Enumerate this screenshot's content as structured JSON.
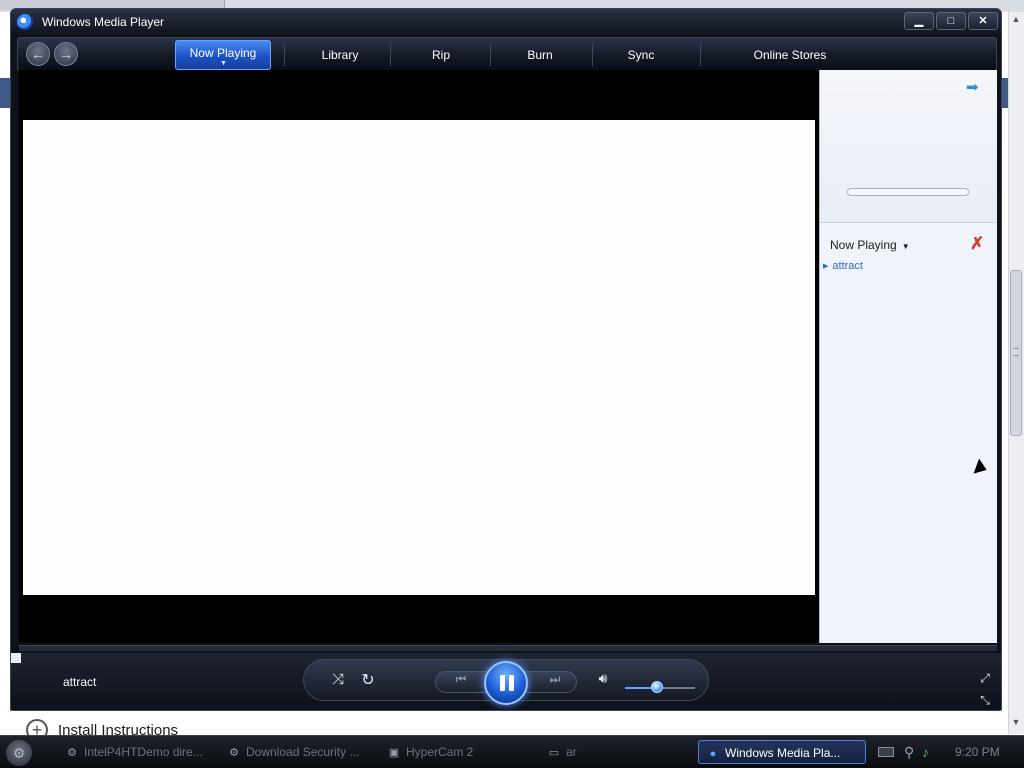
{
  "background": {
    "install_link": "Install Instructions"
  },
  "window": {
    "title": "Windows Media Player",
    "controls": {
      "minimize": "▁",
      "maximize": "□",
      "close": "✕"
    }
  },
  "nav": {
    "back_icon": "back-arrow-icon",
    "forward_icon": "forward-arrow-icon",
    "tabs": [
      {
        "label": "Now Playing",
        "active": true
      },
      {
        "label": "Library",
        "active": false
      },
      {
        "label": "Rip",
        "active": false
      },
      {
        "label": "Burn",
        "active": false
      },
      {
        "label": "Sync",
        "active": false
      },
      {
        "label": "Online Stores",
        "active": false
      }
    ]
  },
  "side_pane": {
    "header": "Now Playing",
    "playlist": [
      {
        "title": "attract"
      }
    ]
  },
  "player": {
    "current_track": "attract",
    "state": "playing",
    "volume": 0.45
  },
  "taskbar": {
    "items": [
      {
        "label": "IntelP4HTDemo dire..."
      },
      {
        "label": "Download Security ..."
      },
      {
        "label": "HyperCam 2"
      },
      {
        "label": "ar"
      },
      {
        "label": "Windows Media Pla..."
      }
    ],
    "clock": "9:20 PM"
  },
  "colors": {
    "accent": "#1d52c4",
    "link": "#2a6fc6",
    "clear_red": "#d43a2a"
  }
}
